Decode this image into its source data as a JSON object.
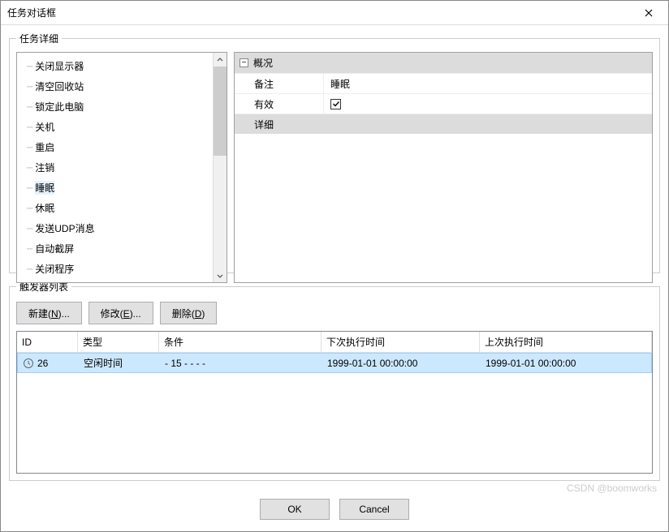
{
  "window": {
    "title": "任务对话框"
  },
  "details": {
    "legend": "任务详细",
    "tree": [
      "关闭显示器",
      "清空回收站",
      "锁定此电脑",
      "关机",
      "重启",
      "注销",
      "睡眠",
      "休眠",
      "发送UDP消息",
      "自动截屏",
      "关闭程序"
    ],
    "selected_index": 6,
    "props": {
      "overview_label": "概况",
      "remark_label": "备注",
      "remark_value": "睡眠",
      "valid_label": "有效",
      "valid_checked": true,
      "detail_label": "详细"
    }
  },
  "triggers": {
    "legend": "触发器列表",
    "toolbar": {
      "new_label_prefix": "新建(",
      "new_key": "N",
      "new_label_suffix": ")...",
      "edit_label_prefix": "修改(",
      "edit_key": "E",
      "edit_label_suffix": ")...",
      "delete_label_prefix": "删除(",
      "delete_key": "D",
      "delete_label_suffix": ")"
    },
    "columns": {
      "id": "ID",
      "type": "类型",
      "condition": "条件",
      "next": "下次执行时间",
      "last": "上次执行时间"
    },
    "rows": [
      {
        "id": "26",
        "type": "空闲时间",
        "condition": "- 15 - - - -",
        "next": "1999-01-01 00:00:00",
        "last": "1999-01-01 00:00:00"
      }
    ]
  },
  "footer": {
    "ok": "OK",
    "cancel": "Cancel"
  },
  "watermark": "CSDN @boomworks"
}
